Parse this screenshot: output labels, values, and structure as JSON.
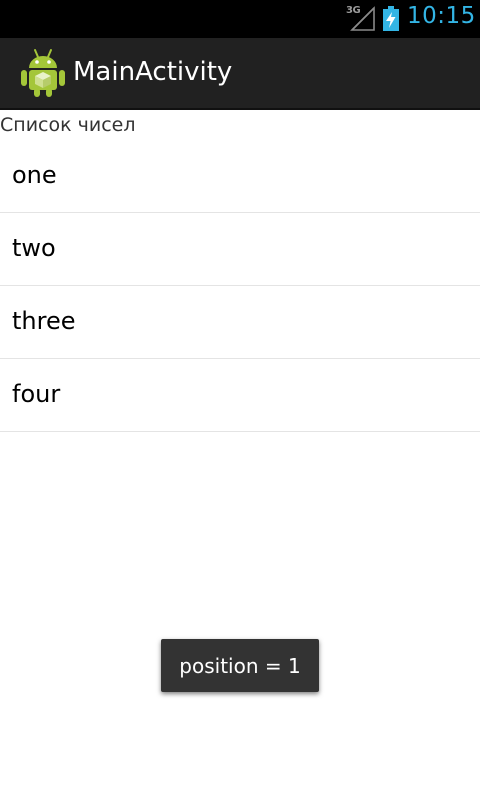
{
  "status_bar": {
    "network_label": "3G",
    "time": "10:15"
  },
  "action_bar": {
    "title": "MainActivity"
  },
  "content": {
    "header": "Список чисел",
    "items": [
      {
        "label": "one"
      },
      {
        "label": "two"
      },
      {
        "label": "three"
      },
      {
        "label": "four"
      }
    ]
  },
  "toast": {
    "text": "position = 1"
  },
  "colors": {
    "clock": "#33b5e5",
    "status_bar_bg": "#000000",
    "action_bar_bg": "#212121",
    "toast_bg": "#333333",
    "android_green": "#a4c639"
  }
}
